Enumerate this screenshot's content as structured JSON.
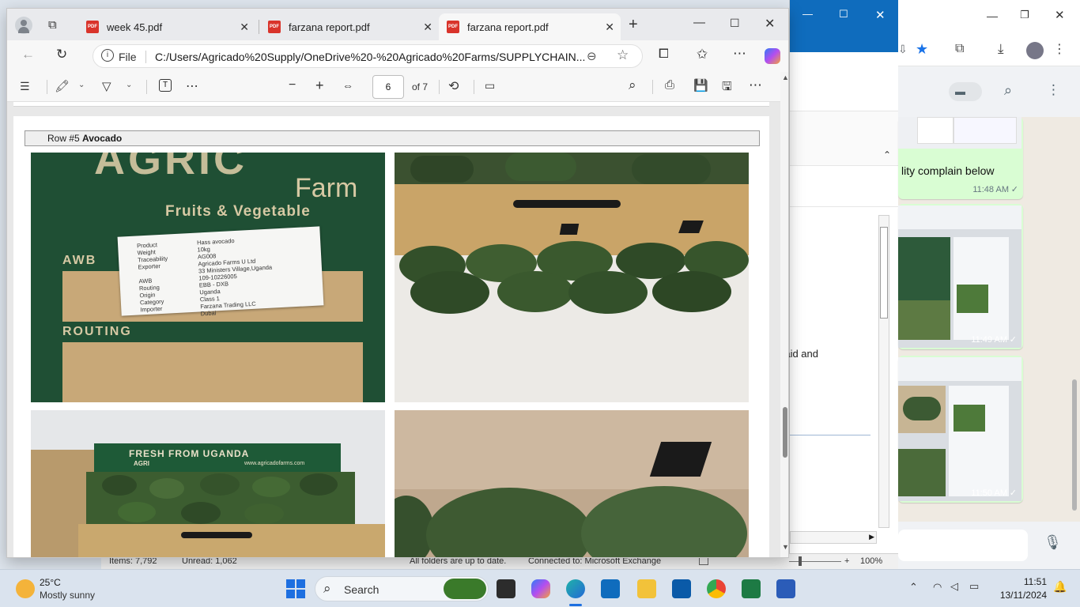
{
  "browser": {
    "tabs": [
      {
        "label": "week 45.pdf",
        "active": false
      },
      {
        "label": "farzana report.pdf",
        "active": false
      },
      {
        "label": "farzana report.pdf",
        "active": true
      }
    ],
    "address_label": "File",
    "url": "C:/Users/Agricado%20Supply/OneDrive%20-%20Agricado%20Farms/SUPPLYCHAIN..."
  },
  "pdf_toolbar": {
    "page_number": "6",
    "page_total": "of 7"
  },
  "pdf_page": {
    "row_prefix": "Row #5",
    "row_title": "Avocado",
    "photo1": {
      "brand_top": "AGRIC",
      "brand_farm": "Farm",
      "tagline": "Fruits & Vegetable",
      "awb_label": "AWB",
      "routing_label": "ROUTING",
      "label_keys": [
        "Product",
        "Weight",
        "Traceability",
        "Exporter",
        "AWB",
        "Routing",
        "Origin",
        "Category",
        "Importer"
      ],
      "label_values": [
        "Hass avocado",
        "10kg",
        "AG008",
        "Agricado Farms U Ltd",
        "33 Ministers Village,Uganda",
        "109-10226005",
        "EBB - DXB",
        "Uganda",
        "Class 1",
        "Farzana Trading LLC",
        "Dubai"
      ]
    },
    "photo3": {
      "box_text": "FRESH FROM UGANDA",
      "box_brand": "AGRI",
      "box_url": "www.agricadofarms.com"
    }
  },
  "outlook_bg": {
    "text_fragment": "s paid and",
    "status_items": "Items: 7,792",
    "status_unread": "Unread: 1,062",
    "status_folders": "All folders are up to date.",
    "status_connected": "Connected to: Microsoft Exchange",
    "zoom": "100%"
  },
  "whatsapp_bg": {
    "message_text": "lity complain below",
    "time1": "11:48 AM",
    "time2": "11:49 AM",
    "time3": "11:50 AM"
  },
  "taskbar": {
    "weather_temp": "25°C",
    "weather_desc": "Mostly sunny",
    "search_placeholder": "Search",
    "clock_time": "11:51",
    "clock_date": "13/11/2024"
  },
  "colors": {
    "accent_blue": "#0f6cbd",
    "pdf_red": "#d9342b",
    "wa_bubble": "#d9fdd3",
    "box_green": "#1f4f34"
  }
}
